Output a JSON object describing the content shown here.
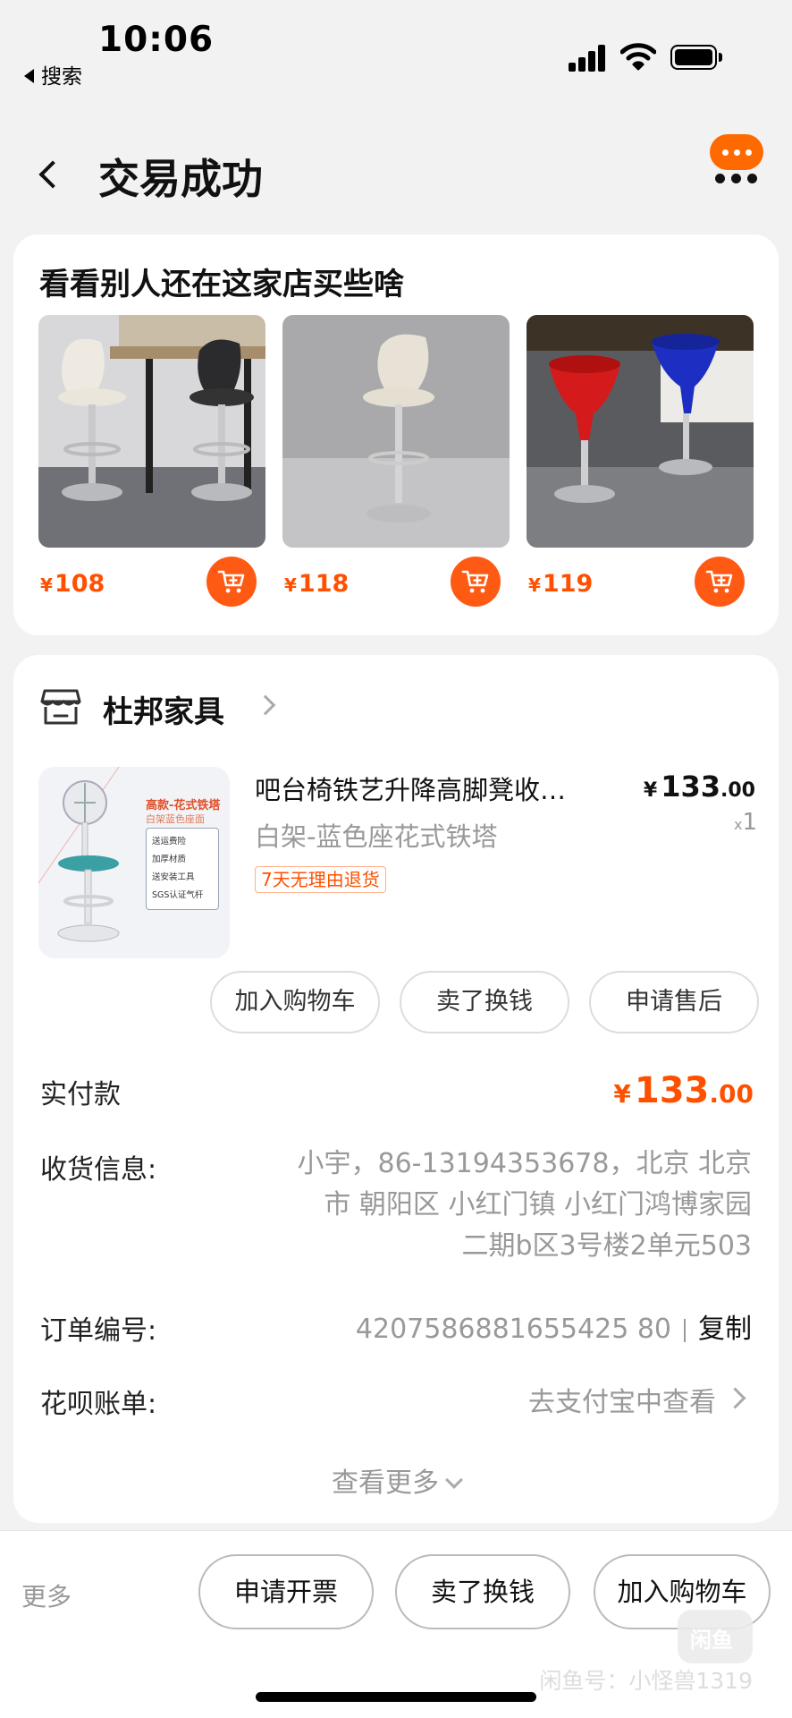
{
  "status_bar": {
    "time": "10:06",
    "back_label": "搜索"
  },
  "nav": {
    "title": "交易成功"
  },
  "recommendations": {
    "title": "看看别人还在这家店买些啥",
    "items": [
      {
        "price": "108",
        "currency": "¥"
      },
      {
        "price": "118",
        "currency": "¥"
      },
      {
        "price": "119",
        "currency": "¥"
      }
    ]
  },
  "shop": {
    "name": "杜邦家具"
  },
  "product": {
    "title": "吧台椅铁艺升降高脚凳收…",
    "sku": "白架-蓝色座花式铁塔",
    "tag": "7天无理由退货",
    "currency": "¥",
    "price_int": "133",
    "price_dec": ".00",
    "qty_prefix": "x",
    "qty": "1",
    "image_text": {
      "title": "高款-花式铁塔",
      "subtitle": "白架蓝色座面",
      "features": [
        "送运费险",
        "加厚材质",
        "送安装工具",
        "SGS认证气杆"
      ]
    }
  },
  "actions": {
    "add_cart": "加入购物车",
    "sell": "卖了换钱",
    "after_sale": "申请售后"
  },
  "paid": {
    "label": "实付款",
    "currency": "¥",
    "int": "133",
    "dec": ".00"
  },
  "shipping": {
    "label": "收货信息:",
    "line1": "小宇，86-13194353678，北京 北京",
    "line2": "市 朝阳区 小红门镇 小红门鸿博家园",
    "line3": "二期b区3号楼2单元503"
  },
  "order": {
    "label": "订单编号:",
    "number": "4207586881655425 80",
    "copy": "复制"
  },
  "huabei": {
    "label": "花呗账单:",
    "link": "去支付宝中查看"
  },
  "more": {
    "label": "查看更多"
  },
  "bottom": {
    "more": "更多",
    "invoice": "申请开票",
    "sell": "卖了换钱",
    "add_cart": "加入购物车",
    "watermark": "闲鱼号：小怪兽1319",
    "watermark_badge": "闲鱼"
  },
  "colors": {
    "accent": "#ff5000",
    "cart_button": "#ff5a14",
    "background": "#f2f2f2"
  }
}
